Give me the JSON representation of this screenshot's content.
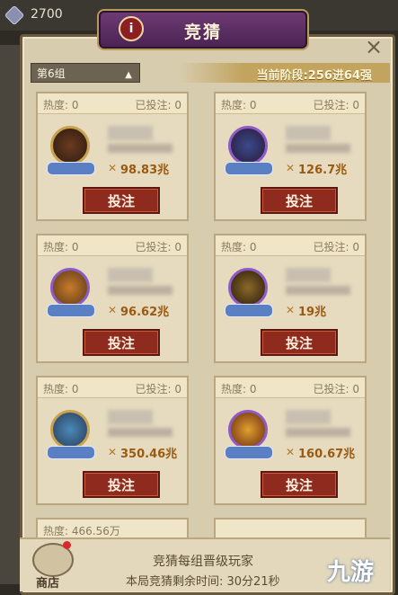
{
  "top": {
    "currency_amount": "2700"
  },
  "panel": {
    "title": "竞猜",
    "group": "第6组",
    "stage": "当前阶段:256进64强",
    "close": "×",
    "info": "i"
  },
  "cards": [
    {
      "heat": "热度: 0",
      "bet": "已投注: 0",
      "power": "98.83兆",
      "button": "投注"
    },
    {
      "heat": "热度: 0",
      "bet": "已投注: 0",
      "power": "126.7兆",
      "button": "投注"
    },
    {
      "heat": "热度: 0",
      "bet": "已投注: 0",
      "power": "96.62兆",
      "button": "投注"
    },
    {
      "heat": "热度: 0",
      "bet": "已投注: 0",
      "power": "19兆",
      "button": "投注"
    },
    {
      "heat": "热度: 0",
      "bet": "已投注: 0",
      "power": "350.46兆",
      "button": "投注"
    },
    {
      "heat": "热度: 0",
      "bet": "已投注: 0",
      "power": "160.67兆",
      "button": "投注"
    }
  ],
  "partial_card": {
    "heat": "热度: 466.56万"
  },
  "bottom": {
    "shop": "商店",
    "title": "竞猜每组晋级玩家",
    "time": "本局竞猜剩余时间: 30分21秒",
    "watermark": "九游"
  }
}
